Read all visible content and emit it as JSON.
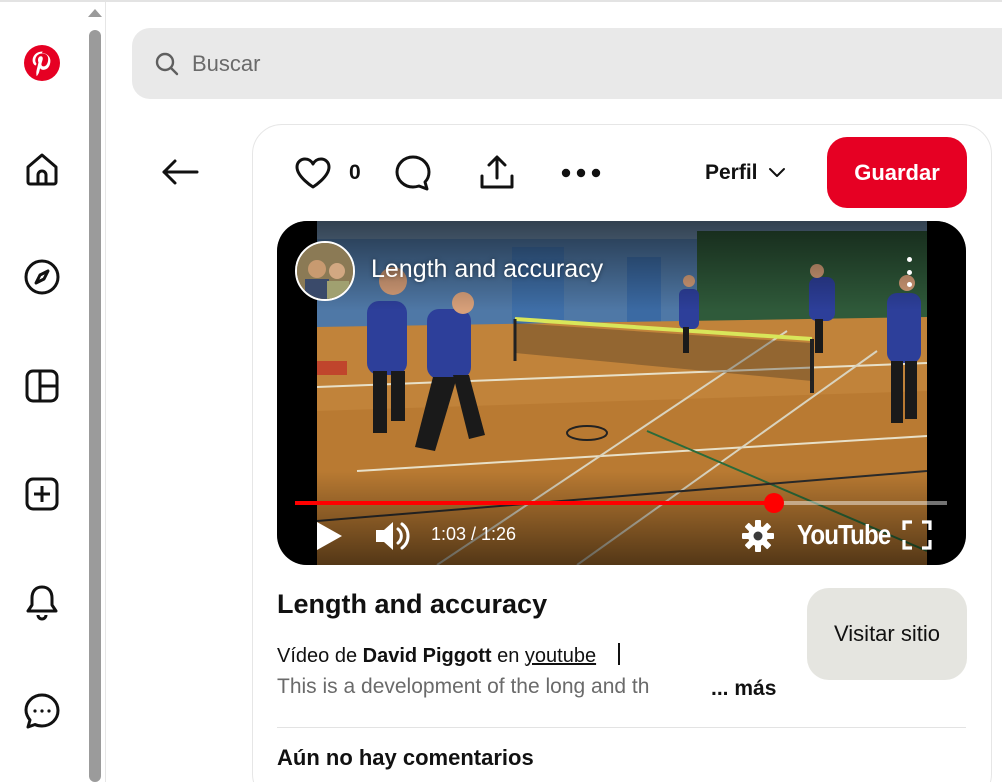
{
  "search": {
    "placeholder": "Buscar"
  },
  "rail": {
    "items": [
      "pinterest-logo",
      "home-icon",
      "explore-icon",
      "boards-icon",
      "create-icon",
      "notifications-icon",
      "messages-icon"
    ]
  },
  "pin_actions": {
    "like_count": "0",
    "profile_label": "Perfil",
    "save_label": "Guardar"
  },
  "video": {
    "title": "Length and accuracy",
    "time": "1:03 / 1:26",
    "progress_fraction": 0.735,
    "logo_text": "YouTube"
  },
  "pin": {
    "title": "Length and accuracy",
    "byline_prefix": "Vídeo de",
    "author": "David Piggott",
    "byline_mid": "en",
    "source": "youtube",
    "description": "This is a development of the long and th",
    "more_label": "... más",
    "visit_label": "Visitar sitio"
  },
  "comments": {
    "heading": "Aún no hay comentarios"
  },
  "colors": {
    "brand": "#e60023",
    "progress": "#ff0000",
    "visit_button_bg": "#e5e5e0"
  }
}
